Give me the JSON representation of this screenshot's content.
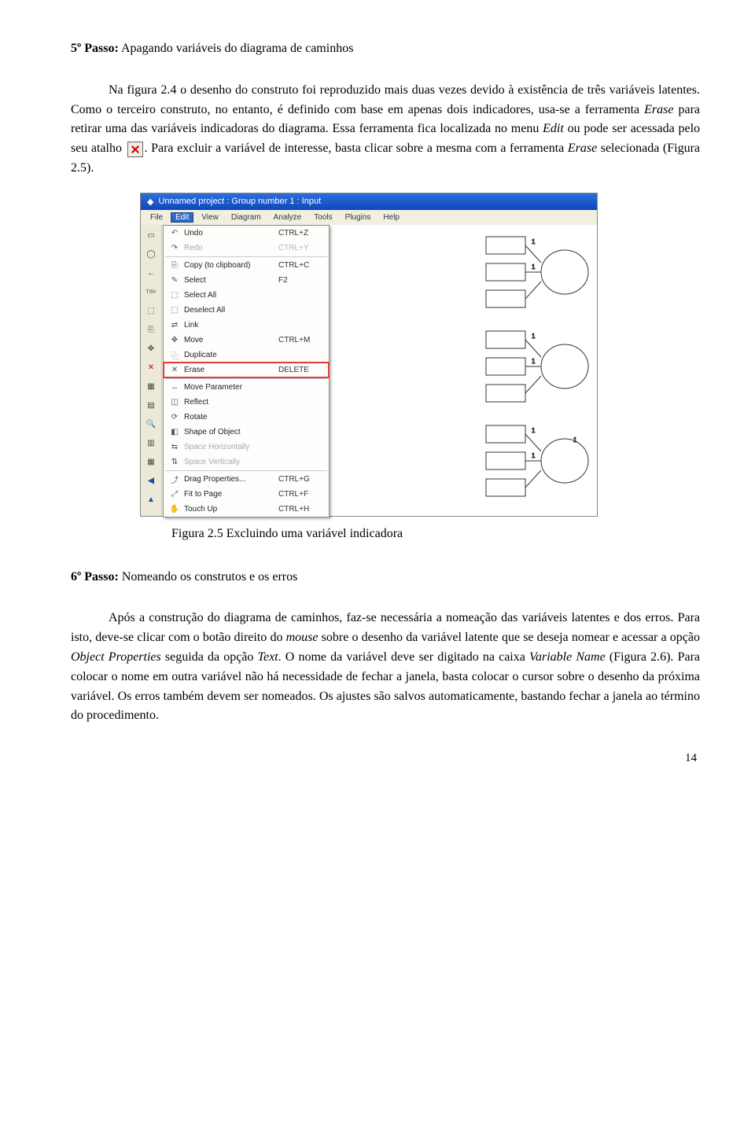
{
  "step5": {
    "heading_bold": "5º Passo:",
    "heading_rest": " Apagando variáveis do diagrama de caminhos",
    "p1a": "Na figura 2.4 o desenho do construto foi reproduzido mais duas vezes devido à existência de três variáveis latentes. Como o terceiro construto, no entanto, é definido com base em apenas dois indicadores, usa-se a ferramenta ",
    "p1_erase": "Erase",
    "p1b": " para retirar uma das variáveis indicadoras do diagrama. Essa ferramenta fica localizada no menu ",
    "p1_edit": "Edit",
    "p1c": " ou pode ser acessada pelo seu atalho ",
    "p1d": ". Para excluir a variável de interesse, basta clicar sobre a mesma com a ferramenta ",
    "p1_erase2": "Erase",
    "p1e": " selecionada (Figura 2.5)."
  },
  "figure": {
    "titlebar": "Unnamed project : Group number 1 : Input",
    "menus": [
      "File",
      "Edit",
      "View",
      "Diagram",
      "Analyze",
      "Tools",
      "Plugins",
      "Help"
    ],
    "dropdown": [
      {
        "icon": "↶",
        "label": "Undo",
        "shortcut": "CTRL+Z",
        "disabled": false
      },
      {
        "icon": "↷",
        "label": "Redo",
        "shortcut": "CTRL+Y",
        "disabled": true
      },
      {
        "icon": "⎘",
        "label": "Copy (to clipboard)",
        "shortcut": "CTRL+C",
        "disabled": false
      },
      {
        "icon": "✎",
        "label": "Select",
        "shortcut": "F2",
        "disabled": false
      },
      {
        "icon": "⬚",
        "label": "Select All",
        "shortcut": "",
        "disabled": false
      },
      {
        "icon": "⬚",
        "label": "Deselect All",
        "shortcut": "",
        "disabled": false
      },
      {
        "icon": "⇄",
        "label": "Link",
        "shortcut": "",
        "disabled": false
      },
      {
        "icon": "✥",
        "label": "Move",
        "shortcut": "CTRL+M",
        "disabled": false
      },
      {
        "icon": "⿻",
        "label": "Duplicate",
        "shortcut": "",
        "disabled": false
      },
      {
        "icon": "✕",
        "label": "Erase",
        "shortcut": "DELETE",
        "disabled": false,
        "highlight": true
      },
      {
        "icon": "↔",
        "label": "Move Parameter",
        "shortcut": "",
        "disabled": false
      },
      {
        "icon": "◫",
        "label": "Reflect",
        "shortcut": "",
        "disabled": false
      },
      {
        "icon": "⟳",
        "label": "Rotate",
        "shortcut": "",
        "disabled": false
      },
      {
        "icon": "◧",
        "label": "Shape of Object",
        "shortcut": "",
        "disabled": false
      },
      {
        "icon": "⇆",
        "label": "Space Horizontally",
        "shortcut": "",
        "disabled": true
      },
      {
        "icon": "⇅",
        "label": "Space Vertically",
        "shortcut": "",
        "disabled": true
      },
      {
        "icon": "⤴",
        "label": "Drag Properties...",
        "shortcut": "CTRL+G",
        "disabled": false
      },
      {
        "icon": "⤢",
        "label": "Fit to Page",
        "shortcut": "CTRL+F",
        "disabled": false
      },
      {
        "icon": "✋",
        "label": "Touch Up",
        "shortcut": "CTRL+H",
        "disabled": false
      }
    ],
    "caption": "Figura 2.5 Excluindo uma variável indicadora"
  },
  "step6": {
    "heading_bold": "6º Passo:",
    "heading_rest": " Nomeando os construtos e os erros",
    "p1a": "Após a construção do diagrama de caminhos, faz-se necessária a nomeação das variáveis latentes e dos erros. Para isto, deve-se clicar com o botão direito do ",
    "p1_mouse": "mouse",
    "p1b": " sobre o desenho da variável latente que se deseja nomear e acessar a opção ",
    "p1_objprop": "Object Properties",
    "p1c": " seguida da opção ",
    "p1_text": "Text",
    "p1d": ". O nome da variável deve ser digitado na caixa ",
    "p1_varname": "Variable Name",
    "p1e": " (Figura 2.6). Para colocar o nome em outra variável não há necessidade de fechar a janela, basta colocar o cursor sobre o desenho da próxima variável. Os erros também devem ser nomeados. Os ajustes são salvos automaticamente, bastando fechar a janela ao término do procedimento."
  },
  "page_number": "14"
}
